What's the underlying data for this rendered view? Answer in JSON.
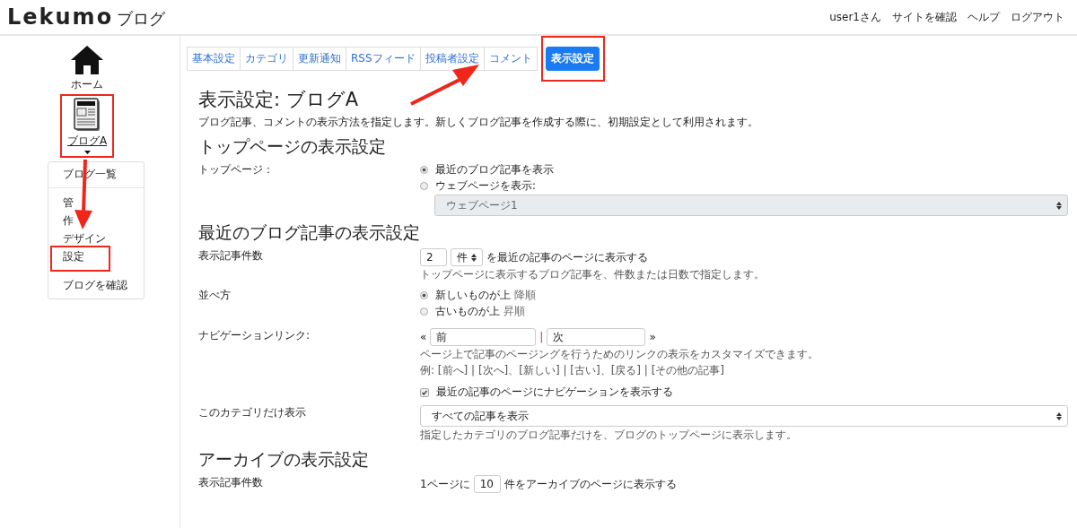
{
  "header": {
    "logo": "Lekumo",
    "logo_suffix": "ブログ",
    "nav": [
      "user1さん",
      "サイトを確認",
      "ヘルプ",
      "ログアウト"
    ]
  },
  "sidebar": {
    "home_label": "ホーム",
    "blog_label": "ブログA",
    "menu_groups": [
      {
        "items": [
          "ブログ一覧"
        ]
      },
      {
        "items": [
          "管",
          "作",
          "デザイン",
          "設定",
          "ブログを確認"
        ]
      }
    ]
  },
  "tabs": [
    {
      "label": "基本設定",
      "selected": false
    },
    {
      "label": "カテゴリ",
      "selected": false
    },
    {
      "label": "更新通知",
      "selected": false
    },
    {
      "label": "RSSフィード",
      "selected": false
    },
    {
      "label": "投稿者設定",
      "selected": false
    },
    {
      "label": "コメント",
      "selected": false
    },
    {
      "label": "表示設定",
      "selected": true
    }
  ],
  "page": {
    "title": "表示設定: ブログA",
    "description": "ブログ記事、コメントの表示方法を指定します。新しくブログ記事を作成する際に、初期設定として利用されます。",
    "sections": [
      {
        "heading": "トップページの表示設定",
        "rows": [
          {
            "kind": "radio",
            "label": "トップページ：",
            "options": [
              {
                "label": "最近のブログ記事を表示",
                "selected": true
              },
              {
                "label": "ウェブページを表示:",
                "selected": false
              }
            ],
            "select": "ウェブページ1"
          }
        ]
      },
      {
        "heading": "最近のブログ記事の表示設定",
        "rows": [
          {
            "kind": "count",
            "label": "表示記事件数",
            "value": "2",
            "unit": "件",
            "suffix": "を最近の記事のページに表示する",
            "help": "トップページに表示するブログ記事を、件数または日数で指定します。"
          },
          {
            "kind": "radio",
            "label": "並べ方",
            "options": [
              {
                "label": "新しいものが上",
                "note": "降順",
                "selected": true
              },
              {
                "label": "古いものが上",
                "note": "昇順",
                "selected": false
              }
            ]
          },
          {
            "kind": "nav",
            "label": "ナビゲーションリンク:",
            "open": "«",
            "prev": "前",
            "sep": "|",
            "next": "次",
            "close": "»",
            "help": "ページ上で記事のページングを行うためのリンクの表示をカスタマイズできます。",
            "example": "例: [前へ] | [次へ]、[新しい] | [古い]、[戻る] | [その他の記事]",
            "checkbox": {
              "label": "最近の記事のページにナビゲーションを表示する",
              "checked": true
            }
          },
          {
            "kind": "select",
            "label": "このカテゴリだけ表示",
            "value": "すべての記事を表示",
            "help": "指定したカテゴリのブログ記事だけを、ブログのトップページに表示します。"
          }
        ]
      },
      {
        "heading": "アーカイブの表示設定",
        "rows": [
          {
            "kind": "inline",
            "label": "表示記事件数",
            "prefix": "1ページに",
            "value": "10",
            "suffix": "件をアーカイブのページに表示する"
          }
        ]
      }
    ]
  }
}
